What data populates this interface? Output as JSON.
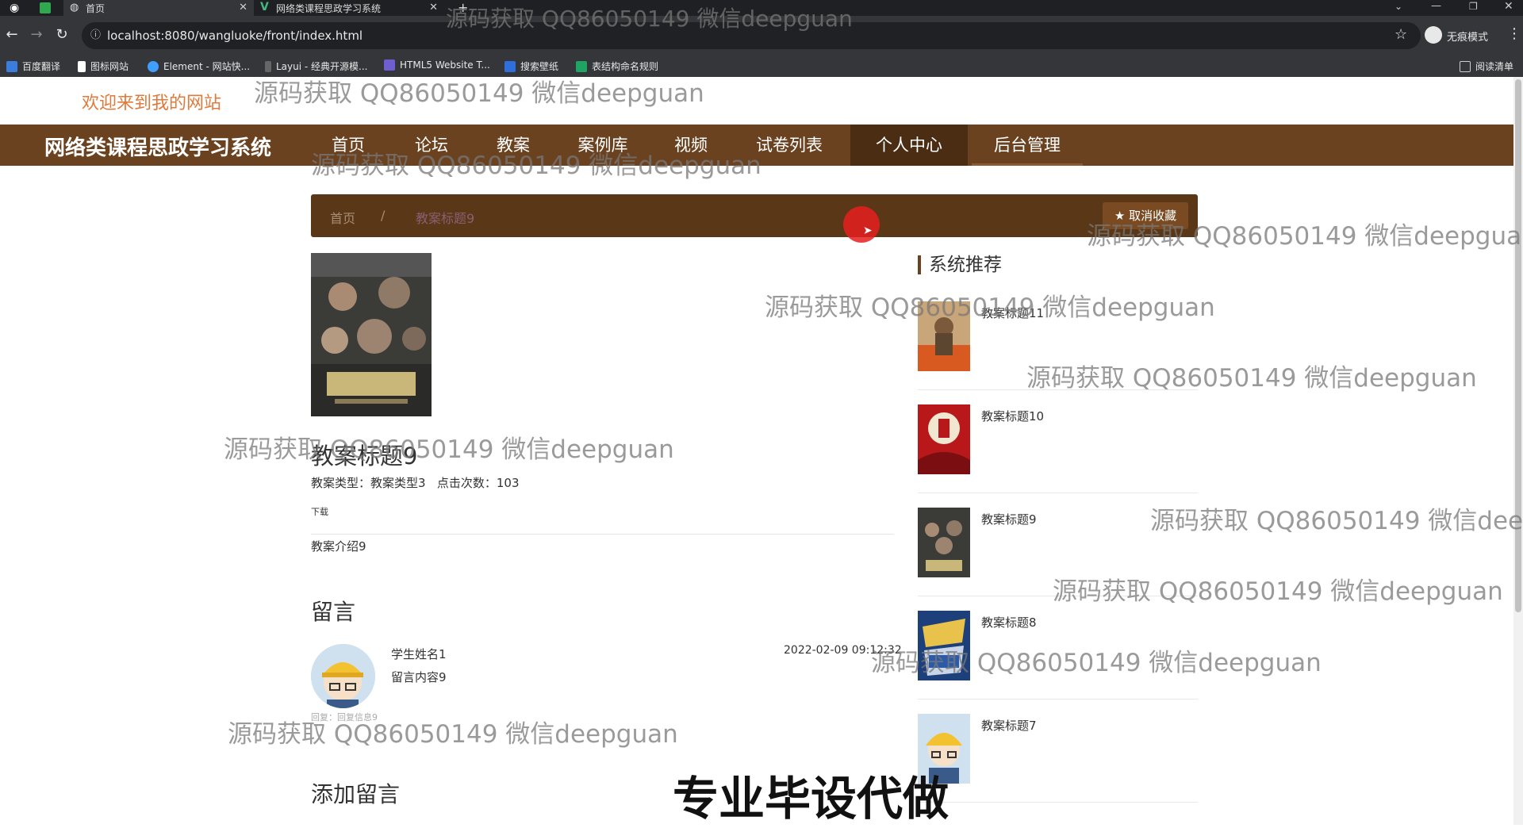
{
  "browser": {
    "tabs": [
      {
        "label": "首页",
        "active": true
      },
      {
        "label": "网络类课程思政学习系统",
        "active": false
      }
    ],
    "url": "localhost:8080/wangluoke/front/index.html",
    "profile_label": "无痕模式",
    "bookmarks": [
      "百度翻译",
      "图标网站",
      "Element - 网站快...",
      "Layui - 经典开源模...",
      "HTML5 Website T...",
      "搜索壁纸",
      "表结构命名规则"
    ],
    "reading_list": "阅读清单"
  },
  "site": {
    "welcome": "欢迎来到我的网站",
    "brand": "网络类课程思政学习系统",
    "nav": [
      "首页",
      "论坛",
      "教案",
      "案例库",
      "视频",
      "试卷列表",
      "个人中心",
      "后台管理"
    ],
    "active_nav": "个人中心"
  },
  "breadcrumb": {
    "home": "首页",
    "sep": "/",
    "current": "教案标题9"
  },
  "fav_button": "取消收藏",
  "detail": {
    "title": "教案标题9",
    "type_label": "教案类型：",
    "type_value": "教案类型3",
    "clicks_label": "点击次数：",
    "clicks_value": "103",
    "download": "下载",
    "intro": "教案介绍9"
  },
  "messages": {
    "heading": "留言",
    "items": [
      {
        "name": "学生姓名1",
        "content": "留言内容9",
        "date": "2022-02-09 09:12:32",
        "reply": "回复：回复信息9"
      }
    ],
    "add_heading": "添加留言"
  },
  "recommend": {
    "heading": "系统推荐",
    "items": [
      "教案标题11",
      "教案标题10",
      "教案标题9",
      "教案标题8",
      "教案标题7"
    ]
  },
  "watermark": "源码获取 QQ86050149 微信deepguan",
  "promo": "专业毕设代做",
  "colors": {
    "nav": "#6b4220",
    "nav_active": "#4b2d14",
    "breadcrumb": "#5a3717",
    "welcome": "#e0793a"
  }
}
